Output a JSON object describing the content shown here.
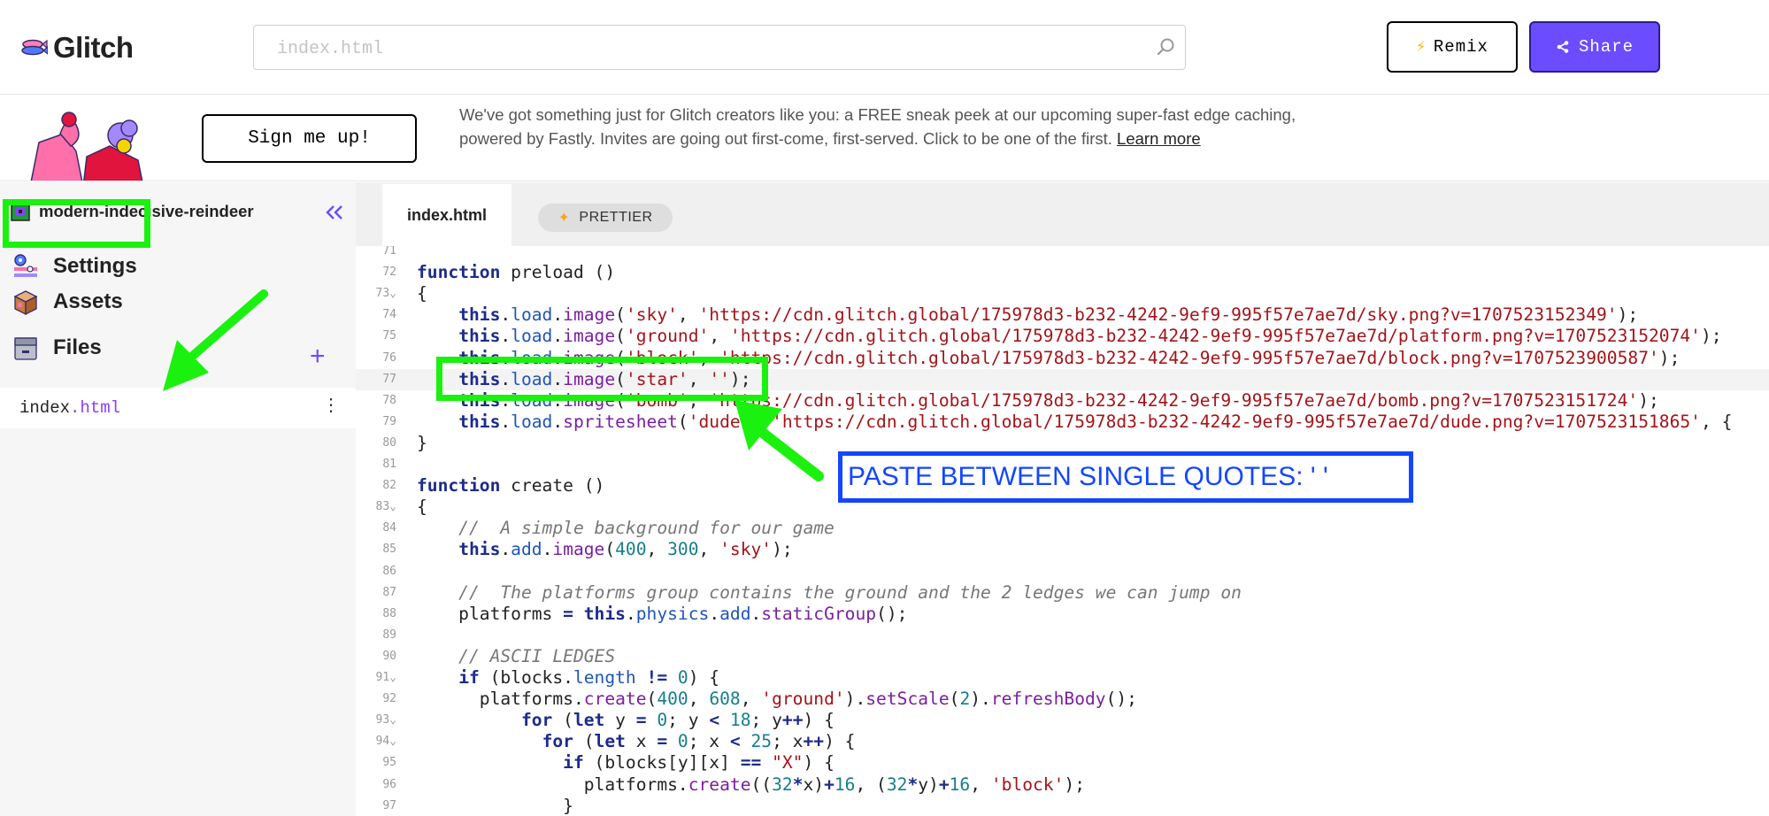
{
  "header": {
    "logo_text": "Glitch",
    "search_placeholder": "index.html",
    "remix_label": "Remix",
    "share_label": "Share"
  },
  "banner": {
    "signup_label": "Sign me up!",
    "text": "We've got something just for Glitch creators like you: a FREE sneak peek at our upcoming super-fast edge caching, powered by Fastly. Invites are going out first-come, first-served. Click to be one of the first. ",
    "link_text": "Learn more"
  },
  "sidebar": {
    "project_name": "modern-indecisive-reindeer",
    "items": [
      {
        "label": "Settings",
        "icon": "settings-icon"
      },
      {
        "label": "Assets",
        "icon": "assets-box-icon"
      },
      {
        "label": "Files",
        "icon": "files-drawer-icon"
      }
    ],
    "file": {
      "base": "index",
      "ext": ".html"
    }
  },
  "tabs": {
    "active": "index.html",
    "prettier_label": "PRETTIER"
  },
  "editor": {
    "lines": [
      {
        "n": "71",
        "code": ""
      },
      {
        "n": "72",
        "code": "function preload ()"
      },
      {
        "n": "73",
        "code": "{"
      },
      {
        "n": "74",
        "code": "    this.load.image('sky', 'https://cdn.glitch.global/175978d3-b232-4242-9ef9-995f57e7ae7d/sky.png?v=1707523152349');"
      },
      {
        "n": "75",
        "code": "    this.load.image('ground', 'https://cdn.glitch.global/175978d3-b232-4242-9ef9-995f57e7ae7d/platform.png?v=1707523152074');"
      },
      {
        "n": "76",
        "code": "    this.load.image('block', 'https://cdn.glitch.global/175978d3-b232-4242-9ef9-995f57e7ae7d/block.png?v=1707523900587');"
      },
      {
        "n": "77",
        "code": "    this.load.image('star', '');"
      },
      {
        "n": "78",
        "code": "    this.load.image('bomb', 'https://cdn.glitch.global/175978d3-b232-4242-9ef9-995f57e7ae7d/bomb.png?v=1707523151724');"
      },
      {
        "n": "79",
        "code": "    this.load.spritesheet('dude', 'https://cdn.glitch.global/175978d3-b232-4242-9ef9-995f57e7ae7d/dude.png?v=1707523151865', {"
      },
      {
        "n": "80",
        "code": "}"
      },
      {
        "n": "81",
        "code": ""
      },
      {
        "n": "82",
        "code": "function create ()"
      },
      {
        "n": "83",
        "code": "{"
      },
      {
        "n": "84",
        "code": "    //  A simple background for our game"
      },
      {
        "n": "85",
        "code": "    this.add.image(400, 300, 'sky');"
      },
      {
        "n": "86",
        "code": ""
      },
      {
        "n": "87",
        "code": "    //  The platforms group contains the ground and the 2 ledges we can jump on"
      },
      {
        "n": "88",
        "code": "    platforms = this.physics.add.staticGroup();"
      },
      {
        "n": "89",
        "code": ""
      },
      {
        "n": "90",
        "code": "    // ASCII LEDGES"
      },
      {
        "n": "91",
        "code": "    if (blocks.length != 0) {"
      },
      {
        "n": "92",
        "code": "      platforms.create(400, 608, 'ground').setScale(2).refreshBody();"
      },
      {
        "n": "93",
        "code": "          for (let y = 0; y < 18; y++) {"
      },
      {
        "n": "94",
        "code": "            for (let x = 0; x < 25; x++) {"
      },
      {
        "n": "95",
        "code": "              if (blocks[y][x] == \"X\") {"
      },
      {
        "n": "96",
        "code": "                platforms.create((32*x)+16, (32*y)+16, 'block');"
      },
      {
        "n": "97",
        "code": "              }"
      }
    ]
  },
  "annotation": {
    "label": "PASTE BETWEEN SINGLE QUOTES: ' '"
  },
  "colors": {
    "accent": "#6b4cff",
    "highlight_green": "#1bf10f",
    "annotation_blue": "#1346ff"
  }
}
